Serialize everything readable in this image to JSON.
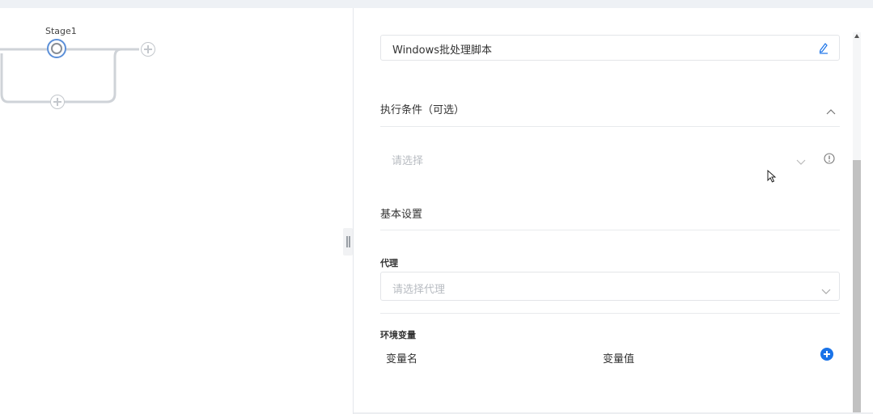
{
  "canvas": {
    "stage_label": "Stage1"
  },
  "panel": {
    "script_type": "Windows批处理脚本",
    "condition_section": "执行条件（可选）",
    "condition_placeholder": "请选择",
    "basic_settings": "基本设置",
    "agent_label": "代理",
    "agent_placeholder": "请选择代理",
    "env_label": "环境变量",
    "env_col_name": "变量名",
    "env_col_value": "变量值"
  },
  "icons": {
    "edit": "edit-pencil-icon",
    "collapse": "chevron-up-icon",
    "dropdown": "chevron-down-icon",
    "info": "info-circle-icon",
    "add": "plus-circle-icon"
  },
  "colors": {
    "accent": "#1a73e8",
    "stage_ring": "#5b8fd8"
  }
}
